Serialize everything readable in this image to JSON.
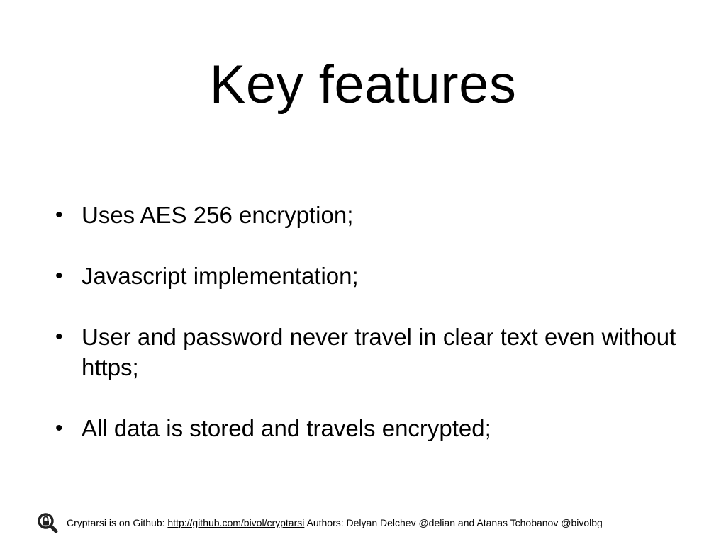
{
  "slide": {
    "title": "Key features",
    "bullets": [
      "Uses AES 256 encryption;",
      "Javascript implementation;",
      "User and password never travel in clear text even without https;",
      "All data is stored and travels encrypted;"
    ],
    "bullet_glyph": "•"
  },
  "footer": {
    "logo_icon": "magnifier-lock-icon",
    "prefix": "Cryptarsi is on Github: ",
    "link_text": "http://github.com/bivol/cryptarsi",
    "suffix": " Authors: Delyan Delchev @delian and Atanas Tchobanov @bivolbg"
  }
}
